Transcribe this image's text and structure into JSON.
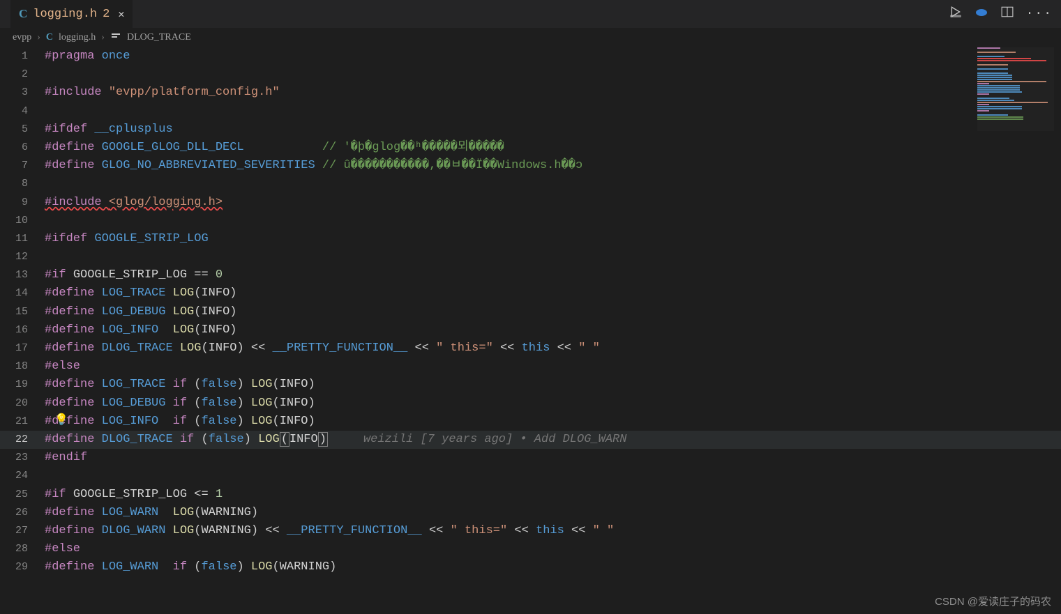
{
  "tab": {
    "icon": "C",
    "name": "logging.h",
    "modified": "2"
  },
  "breadcrumb": {
    "seg1": "evpp",
    "icon": "C",
    "seg2": "logging.h",
    "seg3": "DLOG_TRACE"
  },
  "blame": {
    "author": "weizili",
    "age": "[7 years ago]",
    "sep": "•",
    "msg": "Add DLOG_WARN"
  },
  "watermark": "CSDN @爱读庄子的码农",
  "code": {
    "l1": {
      "a": "#pragma",
      "b": "once"
    },
    "l3": {
      "a": "#include",
      "b": "\"evpp/platform_config.h\""
    },
    "l5": {
      "a": "#ifdef",
      "b": "__cplusplus"
    },
    "l6": {
      "a": "#define",
      "b": "GOOGLE_GLOG_DLL_DECL",
      "c": "// '�þ�glog��ʰ�����뫼�����"
    },
    "l7": {
      "a": "#define",
      "b": "GLOG_NO_ABBREVIATED_SEVERITIES",
      "c": "// û�����������,��ﾲ��Ï��Windows.h��ɔ"
    },
    "l9": {
      "a": "#include",
      "b": "<glog/logging.h>"
    },
    "l11": {
      "a": "#ifdef",
      "b": "GOOGLE_STRIP_LOG"
    },
    "l13": {
      "a": "#if",
      "b": "GOOGLE_STRIP_LOG",
      "c": "==",
      "d": "0"
    },
    "l14": {
      "a": "#define",
      "b": "LOG_TRACE",
      "c": "LOG",
      "d": "(INFO)"
    },
    "l15": {
      "a": "#define",
      "b": "LOG_DEBUG",
      "c": "LOG",
      "d": "(INFO)"
    },
    "l16": {
      "a": "#define",
      "b": "LOG_INFO ",
      "c": "LOG",
      "d": "(INFO)"
    },
    "l17": {
      "a": "#define",
      "b": "DLOG_TRACE",
      "c": "LOG",
      "d": "(INFO)",
      "e": "<<",
      "f": "__PRETTY_FUNCTION__",
      "g": "<<",
      "h": "\" this=\"",
      "i": "<<",
      "j": "this",
      "k": "<<",
      "l": "\" \""
    },
    "l18": {
      "a": "#else"
    },
    "l19": {
      "a": "#define",
      "b": "LOG_TRACE",
      "c": "if",
      "d": "(",
      "e": "false",
      "f": ")",
      "g": "LOG",
      "h": "(INFO)"
    },
    "l20": {
      "a": "#define",
      "b": "LOG_DEBUG",
      "c": "if",
      "d": "(",
      "e": "false",
      "f": ")",
      "g": "LOG",
      "h": "(INFO)"
    },
    "l21": {
      "a": "#define",
      "b": "LOG_INFO ",
      "c": "if",
      "d": "(",
      "e": "false",
      "f": ")",
      "g": "LOG",
      "h": "(INFO)"
    },
    "l22": {
      "a": "#define",
      "b": "DLOG_TRACE",
      "c": "if",
      "d": "(",
      "e": "false",
      "f": ")",
      "g": "LOG",
      "h": "(",
      "i": "INFO",
      "j": ")"
    },
    "l23": {
      "a": "#endif"
    },
    "l25": {
      "a": "#if",
      "b": "GOOGLE_STRIP_LOG",
      "c": "<=",
      "d": "1"
    },
    "l26": {
      "a": "#define",
      "b": "LOG_WARN ",
      "c": "LOG",
      "d": "(WARNING)"
    },
    "l27": {
      "a": "#define",
      "b": "DLOG_WARN",
      "c": "LOG",
      "d": "(WARNING)",
      "e": "<<",
      "f": "__PRETTY_FUNCTION__",
      "g": "<<",
      "h": "\" this=\"",
      "i": "<<",
      "j": "this",
      "k": "<<",
      "l": "\" \""
    },
    "l28": {
      "a": "#else"
    },
    "l29": {
      "a": "#define",
      "b": "LOG_WARN ",
      "c": "if",
      "d": "(",
      "e": "false",
      "f": ")",
      "g": "LOG",
      "h": "(WARNING)"
    }
  },
  "lines": [
    "1",
    "2",
    "3",
    "4",
    "5",
    "6",
    "7",
    "8",
    "9",
    "10",
    "11",
    "12",
    "13",
    "14",
    "15",
    "16",
    "17",
    "18",
    "19",
    "20",
    "21",
    "22",
    "23",
    "24",
    "25",
    "26",
    "27",
    "28",
    "29"
  ]
}
